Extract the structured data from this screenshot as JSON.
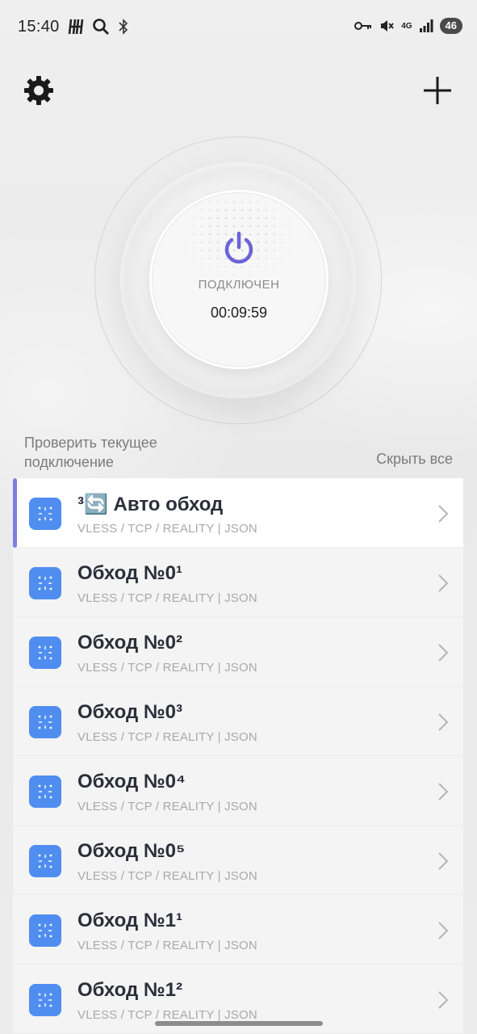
{
  "status_bar": {
    "time": "15:40",
    "network": "4G",
    "battery": "46",
    "icons": [
      "h-icon",
      "search-icon",
      "bluetooth-icon",
      "vpn-key-icon",
      "mute-icon",
      "signal-icon"
    ]
  },
  "header": {
    "settings_icon": "gear-icon",
    "add_icon": "plus-icon"
  },
  "connection": {
    "status": "ПОДКЛЮЧЕН",
    "timer": "00:09:59",
    "power_icon_color": "#6b63d8"
  },
  "actions": {
    "check_connection": "Проверить текущее подключение",
    "hide_all": "Скрыть все"
  },
  "servers": [
    {
      "title": "³🔄 Авто обход",
      "subtitle": "VLESS / TCP / REALITY | JSON",
      "active": true
    },
    {
      "title": "Обход №0¹",
      "subtitle": "VLESS / TCP / REALITY | JSON",
      "active": false
    },
    {
      "title": "Обход №0²",
      "subtitle": "VLESS / TCP / REALITY | JSON",
      "active": false
    },
    {
      "title": "Обход №0³",
      "subtitle": "VLESS / TCP / REALITY | JSON",
      "active": false
    },
    {
      "title": "Обход №0⁴",
      "subtitle": "VLESS / TCP / REALITY | JSON",
      "active": false
    },
    {
      "title": "Обход №0⁵",
      "subtitle": "VLESS / TCP / REALITY | JSON",
      "active": false
    },
    {
      "title": "Обход №1¹",
      "subtitle": "VLESS / TCP / REALITY | JSON",
      "active": false
    },
    {
      "title": "Обход №1²",
      "subtitle": "VLESS / TCP / REALITY | JSON",
      "active": false
    }
  ],
  "colors": {
    "accent": "#7b7fe0",
    "server_icon": "#4f8ef0"
  }
}
